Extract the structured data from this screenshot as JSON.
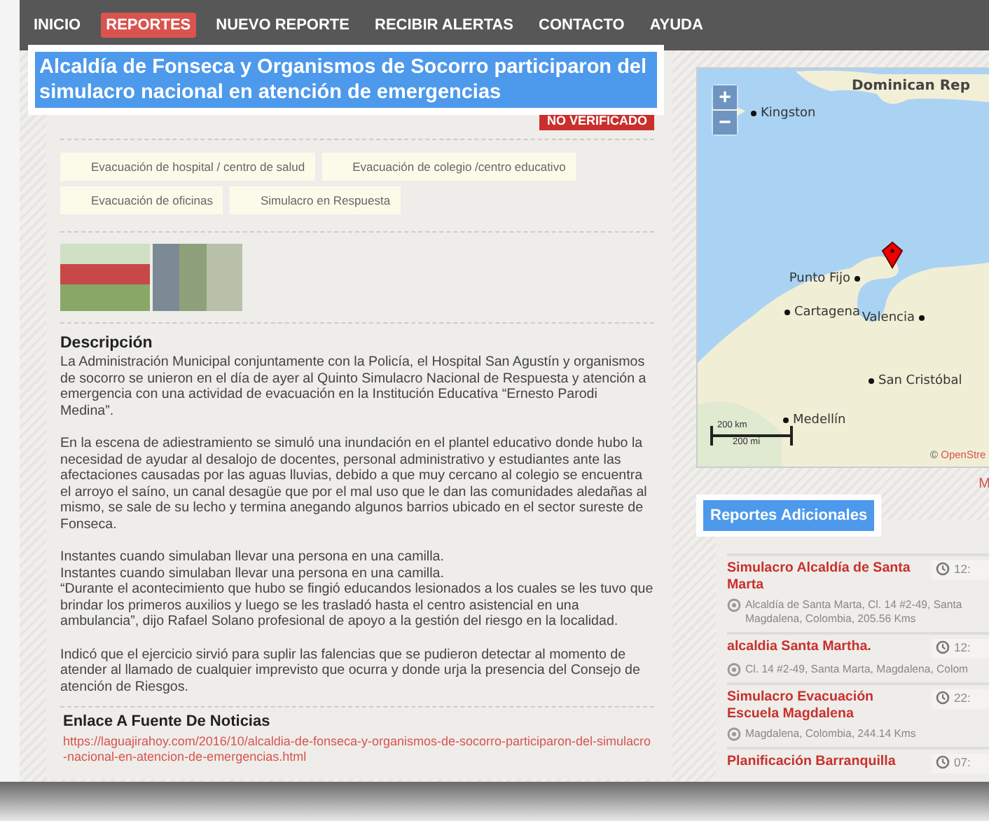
{
  "nav": {
    "items": [
      {
        "label": "INICIO",
        "selected": false
      },
      {
        "label": "REPORTES",
        "selected": true
      },
      {
        "label": "NUEVO REPORTE",
        "selected": false
      },
      {
        "label": "RECIBIR ALERTAS",
        "selected": false
      },
      {
        "label": "CONTACTO",
        "selected": false
      },
      {
        "label": "AYUDA",
        "selected": false
      }
    ]
  },
  "report": {
    "title": "Alcaldía de Fonseca y Organismos de Socorro participaron del simulacro nacional en atención de emergencias",
    "status_badge": "NO VERIFICADO",
    "categories": [
      "Evacuación de hospital / centro de salud",
      "Evacuación de colegio /centro educativo",
      "Evacuación de oficinas",
      "Simulacro en Respuesta"
    ],
    "photos": [
      {
        "kind": "stadium"
      },
      {
        "kind": "stretcher"
      }
    ],
    "description": {
      "heading": "Descripción",
      "paragraphs": [
        {
          "lines": [
            "La Administración Municipal conjuntamente con la Policía, el Hospital San Agustín y organismos de socorro se unieron en el día de ayer al Quinto Simulacro Nacional de Respuesta y atención a emergencia con una actividad de evacuación en la Institución Educativa “Ernesto Parodi Medina”."
          ]
        },
        {
          "lines": [
            "En la escena de adiestramiento se simuló una inundación en el plantel educativo donde hubo la necesidad de ayudar al desalojo de docentes, personal administrativo y estudiantes ante las afectaciones causadas por las aguas lluvias, debido a que muy cercano al colegio se encuentra el arroyo el saíno, un canal desagüe que por el mal uso que le dan las comunidades aledañas al mismo, se sale de su lecho y termina anegando algunos barrios ubicado en el sector sureste de Fonseca."
          ]
        },
        {
          "lines": [
            "Instantes cuando simulaban llevar una persona en una camilla.",
            "Instantes cuando simulaban llevar una persona en una camilla.",
            "“Durante el acontecimiento que hubo se fingió educandos lesionados a los cuales se les tuvo que brindar los primeros auxilios y luego se les trasladó hasta el centro asistencial en una ambulancia”, dijo Rafael Solano profesional de apoyo a la gestión del riesgo en la localidad."
          ]
        },
        {
          "lines": [
            "Indicó que el ejercicio sirvió para suplir las falencias que se pudieron detectar al momento de atender al llamado de cualquier imprevisto que ocurra y donde urja la presencia del Consejo de atención de Riesgos."
          ]
        }
      ]
    },
    "source": {
      "heading": "Enlace A Fuente De Noticias",
      "url": "https://laguajirahoy.com/2016/10/alcaldia-de-fonseca-y-organismos-de-socorro-participaron-del-simulacro-nacional-en-atencion-de-emergencias.html"
    }
  },
  "map": {
    "zoom_in": "+",
    "zoom_out": "−",
    "labels": [
      {
        "text": "Dominican Rep",
        "kind": "country"
      },
      {
        "text": "Kingston",
        "kind": "city"
      },
      {
        "text": "Punto Fijo",
        "kind": "city"
      },
      {
        "text": "Cartagena",
        "kind": "city"
      },
      {
        "text": "Valencia",
        "kind": "city"
      },
      {
        "text": "San Cristóbal",
        "kind": "city"
      },
      {
        "text": "Medellín",
        "kind": "city"
      }
    ],
    "scale": [
      "200 km",
      "200 mi"
    ],
    "attribution_symbol": "©",
    "attribution": "OpenStre",
    "link": "M"
  },
  "additional_reports": {
    "heading": "Reportes Adicionales",
    "items": [
      {
        "title": "Simulacro Alcaldía de Santa Marta",
        "time": "12:",
        "location_lines": [
          "Alcaldía de Santa Marta, Cl. 14 #2-49, Santa",
          "Magdalena, Colombia, 205.56 Kms"
        ]
      },
      {
        "title": "alcaldia Santa Martha.",
        "time": "12:",
        "location_lines": [
          "Cl. 14 #2-49, Santa Marta, Magdalena, Colom"
        ]
      },
      {
        "title": "Simulacro Evacuación Escuela Magdalena",
        "time": "22:",
        "location_lines": [
          "Magdalena, Colombia, 244.14 Kms"
        ]
      },
      {
        "title": "Planificación Barranquilla",
        "time": "07:"
      }
    ]
  }
}
